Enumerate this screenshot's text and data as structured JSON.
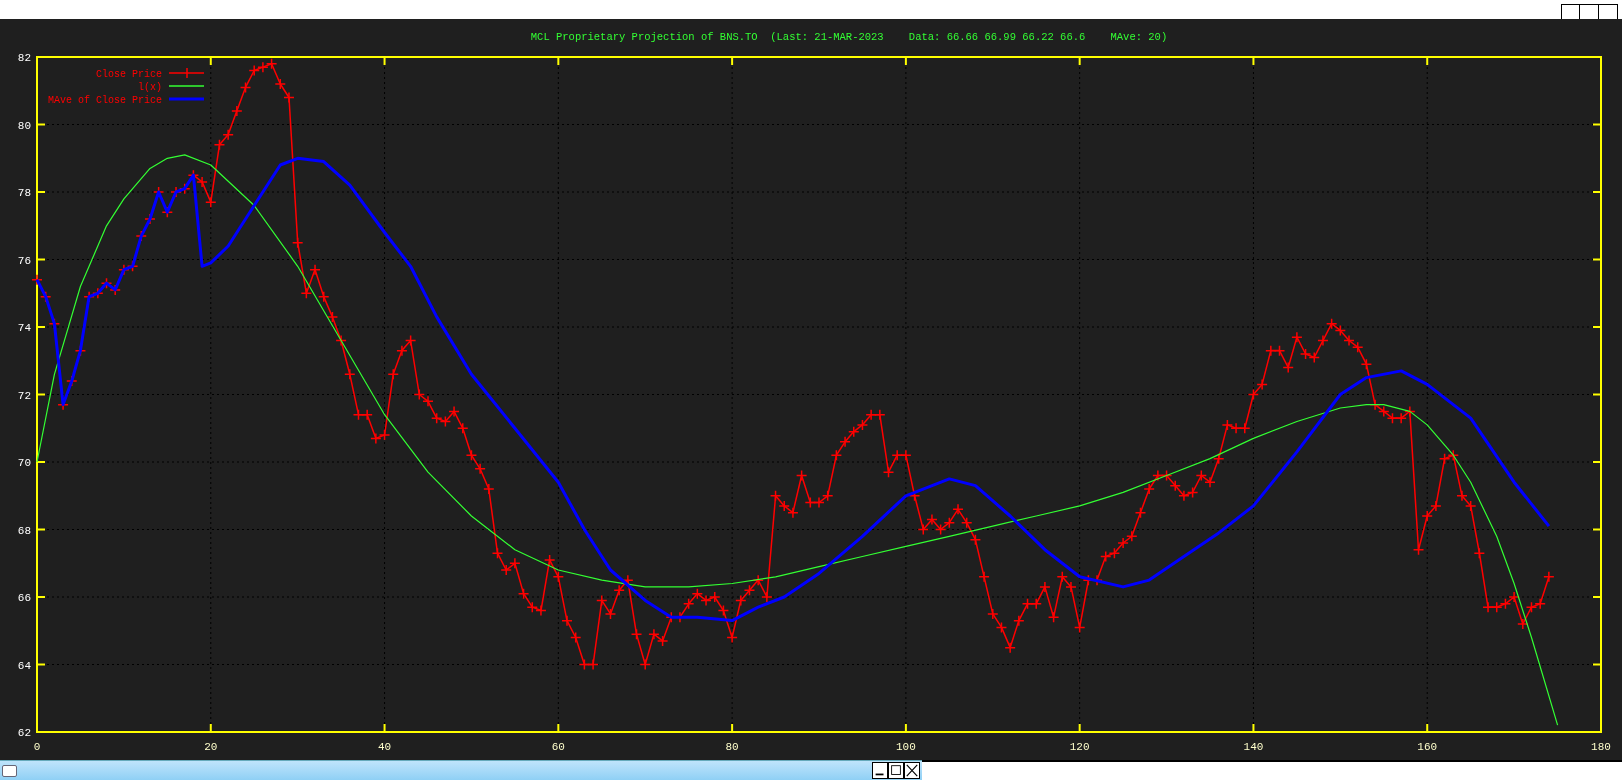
{
  "chart": {
    "chart_data": {
      "type": "line",
      "title": "MCL Proprietary Projection of BNS.TO  (Last: 21-MAR-2023    Data: 66.66 66.99 66.22 66.6    MAve: 20)",
      "xlim": [
        0,
        180
      ],
      "ylim": [
        62,
        82
      ],
      "grid": true,
      "legend": true,
      "xticks": [
        0,
        20,
        40,
        60,
        80,
        100,
        120,
        140,
        160,
        180
      ],
      "yticks": [
        62,
        64,
        66,
        68,
        70,
        72,
        74,
        76,
        78,
        80,
        82
      ],
      "series": [
        {
          "name": "Close Price",
          "color": "#ff0000",
          "marker": "plus",
          "x": [
            0,
            1,
            2,
            3,
            4,
            5,
            6,
            7,
            8,
            9,
            10,
            11,
            12,
            13,
            14,
            15,
            16,
            17,
            18,
            19,
            20,
            21,
            22,
            23,
            24,
            25,
            26,
            27,
            28,
            29,
            30,
            31,
            32,
            33,
            34,
            35,
            36,
            37,
            38,
            39,
            40,
            41,
            42,
            43,
            44,
            45,
            46,
            47,
            48,
            49,
            50,
            51,
            52,
            53,
            54,
            55,
            56,
            57,
            58,
            59,
            60,
            61,
            62,
            63,
            64,
            65,
            66,
            67,
            68,
            69,
            70,
            71,
            72,
            73,
            74,
            75,
            76,
            77,
            78,
            79,
            80,
            81,
            82,
            83,
            84,
            85,
            86,
            87,
            88,
            89,
            90,
            91,
            92,
            93,
            94,
            95,
            96,
            97,
            98,
            99,
            100,
            101,
            102,
            103,
            104,
            105,
            106,
            107,
            108,
            109,
            110,
            111,
            112,
            113,
            114,
            115,
            116,
            117,
            118,
            119,
            120,
            121,
            122,
            123,
            124,
            125,
            126,
            127,
            128,
            129,
            130,
            131,
            132,
            133,
            134,
            135,
            136,
            137,
            138,
            139,
            140,
            141,
            142,
            143,
            144,
            145,
            146,
            147,
            148,
            149,
            150,
            151,
            152,
            153,
            154,
            155,
            156,
            157,
            158,
            159,
            160,
            161,
            162,
            163,
            164,
            165,
            166,
            167,
            168,
            169,
            170,
            171,
            172,
            173,
            174
          ],
          "values": [
            75.4,
            74.9,
            74.1,
            71.7,
            72.4,
            73.3,
            74.9,
            75.0,
            75.3,
            75.1,
            75.7,
            75.8,
            76.7,
            77.2,
            78.0,
            77.4,
            78.0,
            78.1,
            78.5,
            78.3,
            77.7,
            79.4,
            79.7,
            80.4,
            81.1,
            81.6,
            81.7,
            81.8,
            81.2,
            80.8,
            76.5,
            75.0,
            75.7,
            74.9,
            74.3,
            73.6,
            72.6,
            71.4,
            71.4,
            70.7,
            70.8,
            72.6,
            73.3,
            73.6,
            72.0,
            71.8,
            71.3,
            71.2,
            71.5,
            71.0,
            70.2,
            69.8,
            69.2,
            67.3,
            66.8,
            67.0,
            66.1,
            65.7,
            65.6,
            67.1,
            66.6,
            65.3,
            64.8,
            64.0,
            64.0,
            65.9,
            65.5,
            66.2,
            66.5,
            64.9,
            64.0,
            64.9,
            64.7,
            65.4,
            65.4,
            65.8,
            66.1,
            65.9,
            66.0,
            65.6,
            64.8,
            65.9,
            66.2,
            66.5,
            66.0,
            69.0,
            68.7,
            68.5,
            69.6,
            68.8,
            68.8,
            69.0,
            70.2,
            70.6,
            70.9,
            71.1,
            71.4,
            71.4,
            69.7,
            70.2,
            70.2,
            69.0,
            68.0,
            68.3,
            68.0,
            68.2,
            68.6,
            68.2,
            67.7,
            66.6,
            65.5,
            65.1,
            64.5,
            65.3,
            65.8,
            65.8,
            66.3,
            65.4,
            66.6,
            66.3,
            65.1,
            66.5,
            66.5,
            67.2,
            67.3,
            67.6,
            67.8,
            68.5,
            69.2,
            69.6,
            69.6,
            69.3,
            69.0,
            69.1,
            69.6,
            69.4,
            70.1,
            71.1,
            71.0,
            71.0,
            72.0,
            72.3,
            73.3,
            73.3,
            72.8,
            73.7,
            73.2,
            73.1,
            73.6,
            74.1,
            73.9,
            73.6,
            73.4,
            72.9,
            71.7,
            71.5,
            71.3,
            71.3,
            71.5,
            67.4,
            68.4,
            68.7,
            70.1,
            70.2,
            69.0,
            68.7,
            67.3,
            65.7,
            65.7,
            65.8,
            66.0,
            65.2,
            65.7,
            65.8,
            66.6
          ]
        },
        {
          "name": "l(x)",
          "color": "#33ff33",
          "marker": "none",
          "x": [
            0,
            2,
            5,
            8,
            10,
            13,
            15,
            17,
            20,
            25,
            30,
            35,
            40,
            45,
            50,
            55,
            60,
            65,
            70,
            75,
            80,
            85,
            90,
            95,
            100,
            105,
            110,
            115,
            120,
            125,
            130,
            135,
            140,
            145,
            150,
            153,
            155,
            158,
            160,
            163,
            165,
            168,
            170,
            172,
            175
          ],
          "values": [
            70.0,
            72.6,
            75.2,
            77.0,
            77.8,
            78.7,
            79.0,
            79.1,
            78.8,
            77.6,
            75.8,
            73.6,
            71.4,
            69.7,
            68.4,
            67.4,
            66.8,
            66.5,
            66.3,
            66.3,
            66.4,
            66.6,
            66.9,
            67.2,
            67.5,
            67.8,
            68.1,
            68.4,
            68.7,
            69.1,
            69.6,
            70.1,
            70.7,
            71.2,
            71.6,
            71.7,
            71.7,
            71.5,
            71.1,
            70.2,
            69.4,
            67.8,
            66.4,
            64.8,
            62.2
          ]
        },
        {
          "name": "MAve of Close Price",
          "color": "#0000ff",
          "marker": "none",
          "x": [
            0,
            1,
            2,
            3,
            4,
            5,
            6,
            7,
            8,
            9,
            10,
            11,
            12,
            13,
            14,
            15,
            16,
            17,
            18,
            19,
            20,
            22,
            25,
            28,
            30,
            33,
            36,
            40,
            43,
            46,
            50,
            55,
            60,
            63,
            66,
            70,
            73,
            76,
            80,
            83,
            86,
            90,
            95,
            100,
            105,
            108,
            112,
            116,
            120,
            125,
            128,
            132,
            136,
            140,
            145,
            150,
            153,
            157,
            160,
            165,
            170,
            174
          ],
          "values": [
            75.4,
            74.9,
            74.1,
            71.7,
            72.4,
            73.3,
            74.9,
            75.0,
            75.3,
            75.1,
            75.7,
            75.8,
            76.7,
            77.2,
            78.0,
            77.4,
            78.0,
            78.1,
            78.5,
            75.8,
            75.9,
            76.4,
            77.6,
            78.8,
            79.0,
            78.9,
            78.2,
            76.8,
            75.8,
            74.3,
            72.6,
            71.0,
            69.4,
            68.0,
            66.8,
            65.9,
            65.4,
            65.4,
            65.3,
            65.7,
            66.0,
            66.7,
            67.8,
            69.0,
            69.5,
            69.3,
            68.4,
            67.4,
            66.6,
            66.3,
            66.5,
            67.2,
            67.9,
            68.7,
            70.3,
            72.0,
            72.5,
            72.7,
            72.3,
            71.3,
            69.4,
            68.1
          ]
        }
      ]
    }
  }
}
